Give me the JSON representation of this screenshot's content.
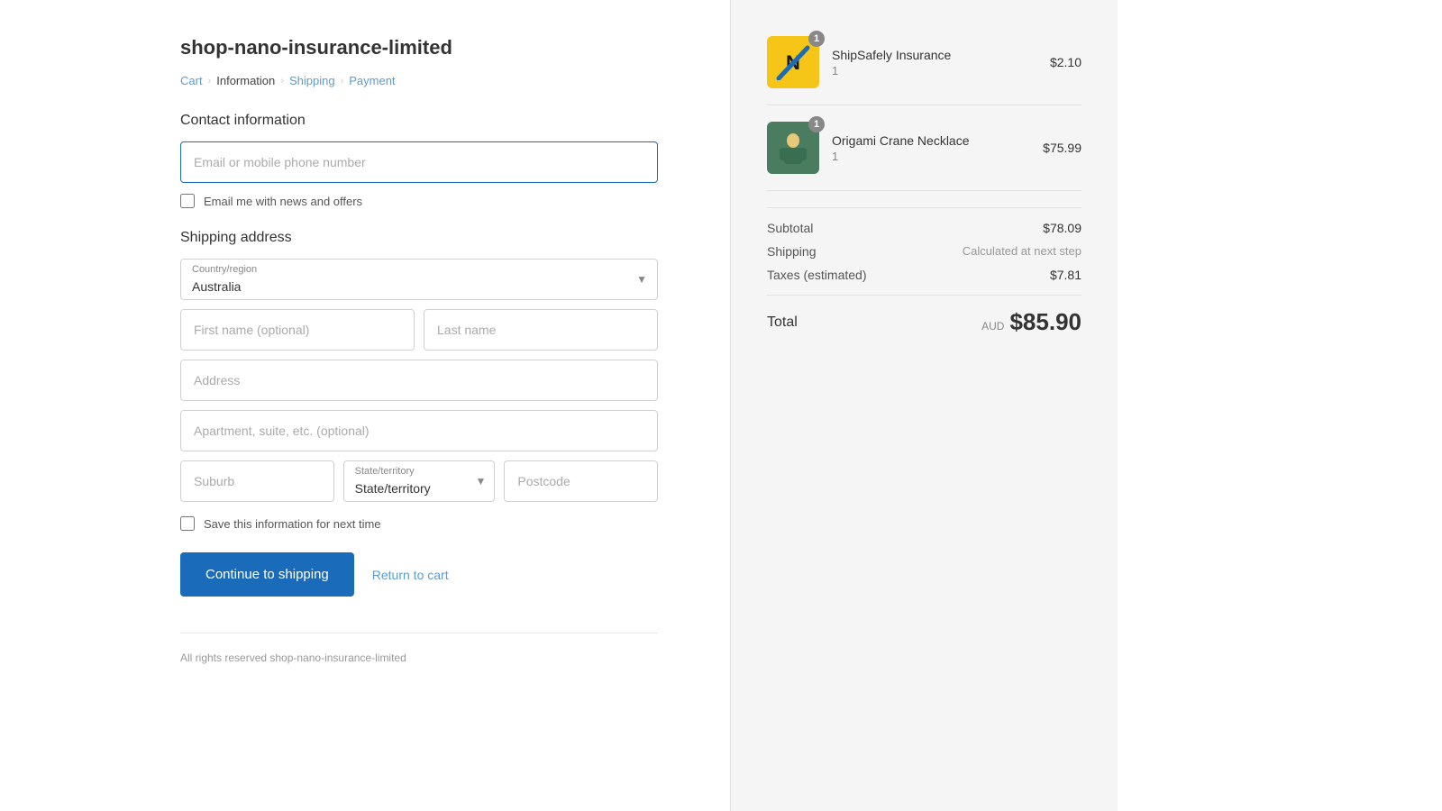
{
  "store": {
    "title": "shop-nano-insurance-limited",
    "footer": "All rights reserved shop-nano-insurance-limited"
  },
  "breadcrumb": {
    "cart": "Cart",
    "information": "Information",
    "shipping": "Shipping",
    "payment": "Payment"
  },
  "contact": {
    "section_title": "Contact information",
    "email_placeholder": "Email or mobile phone number",
    "newsletter_label": "Email me with news and offers"
  },
  "shipping": {
    "section_title": "Shipping address",
    "country_label": "Country/region",
    "country_value": "Australia",
    "first_name_placeholder": "First name (optional)",
    "last_name_placeholder": "Last name",
    "address_placeholder": "Address",
    "apartment_placeholder": "Apartment, suite, etc. (optional)",
    "suburb_placeholder": "Suburb",
    "state_label": "State/territory",
    "state_value": "State/territory",
    "postcode_placeholder": "Postcode",
    "save_label": "Save this information for next time"
  },
  "actions": {
    "continue_label": "Continue to shipping",
    "return_label": "Return to cart"
  },
  "order": {
    "items": [
      {
        "name": "ShipSafely Insurance",
        "qty": "1",
        "price": "$2.10",
        "badge": "1",
        "logo_type": "shipsafely"
      },
      {
        "name": "Origami Crane Necklace",
        "qty": "1",
        "price": "$75.99",
        "badge": "1",
        "logo_type": "necklace"
      }
    ],
    "subtotal_label": "Subtotal",
    "subtotal_value": "$78.09",
    "shipping_label": "Shipping",
    "shipping_value": "Calculated at next step",
    "taxes_label": "Taxes (estimated)",
    "taxes_value": "$7.81",
    "total_label": "Total",
    "total_currency": "AUD",
    "total_amount": "$85.90"
  }
}
